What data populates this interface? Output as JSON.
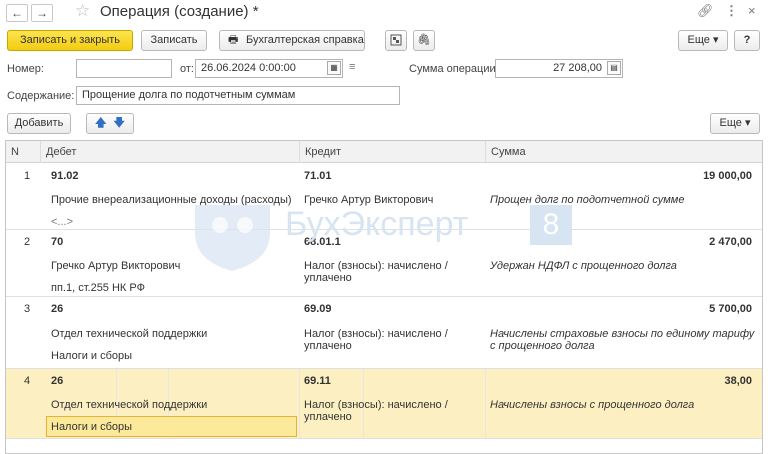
{
  "window": {
    "title": "Операция (создание) *",
    "icons": [
      "link-icon",
      "more-vert-icon",
      "close-icon"
    ]
  },
  "toolbar": {
    "save_close": "Записать и закрыть",
    "save": "Записать",
    "acc_report": "Бухгалтерская справка",
    "more": "Еще",
    "help": "?"
  },
  "form": {
    "number_label": "Номер:",
    "number_value": "",
    "date_label": "от:",
    "date_value": "26.06.2024  0:00:00",
    "sum_label": "Сумма операции:",
    "sum_value": "27 208,00",
    "content_label": "Содержание:",
    "content_value": "Прощение долга по подотчетным суммам"
  },
  "table_toolbar": {
    "add": "Добавить",
    "more": "Еще"
  },
  "table": {
    "columns": [
      "N",
      "Дебет",
      "Кредит",
      "Сумма"
    ],
    "rows": [
      {
        "n": "1",
        "debit": "91.02",
        "credit": "71.01",
        "sum": "19 000,00",
        "debit_sub1": "Прочие внереализационные доходы (расходы)",
        "debit_sub2": "<...>",
        "credit_sub1": "Гречко Артур Викторович",
        "comment": "Прощен долг по подотчетной сумме"
      },
      {
        "n": "2",
        "debit": "70",
        "credit": "68.01.1",
        "sum": "2 470,00",
        "debit_sub1": "Гречко Артур Викторович",
        "debit_sub2": "пп.1, ст.255 НК РФ",
        "credit_sub1": "Налог (взносы): начислено / уплачено",
        "comment": "Удержан НДФЛ с прощенного долга"
      },
      {
        "n": "3",
        "debit": "26",
        "credit": "69.09",
        "sum": "5 700,00",
        "debit_sub1": "Отдел технической поддержки",
        "debit_sub2": "Налоги и сборы",
        "credit_sub1": "Налог (взносы): начислено / уплачено",
        "comment": "Начислены страховые взносы по единому тарифу с прощенного долга"
      },
      {
        "n": "4",
        "debit": "26",
        "credit": "69.11",
        "sum": "38,00",
        "debit_sub1": "Отдел технической поддержки",
        "debit_sub2": "Налоги и сборы",
        "credit_sub1": "Налог (взносы): начислено / уплачено",
        "comment": "Начислены взносы с прощенного долга"
      }
    ]
  },
  "watermark": {
    "text": "БухЭксперт",
    "badge": "8"
  },
  "colors": {
    "primary": "#f4cb10",
    "selected_row": "#fcf0c3",
    "selected_cell": "#fde99a",
    "watermark": "#d7e4f2"
  }
}
